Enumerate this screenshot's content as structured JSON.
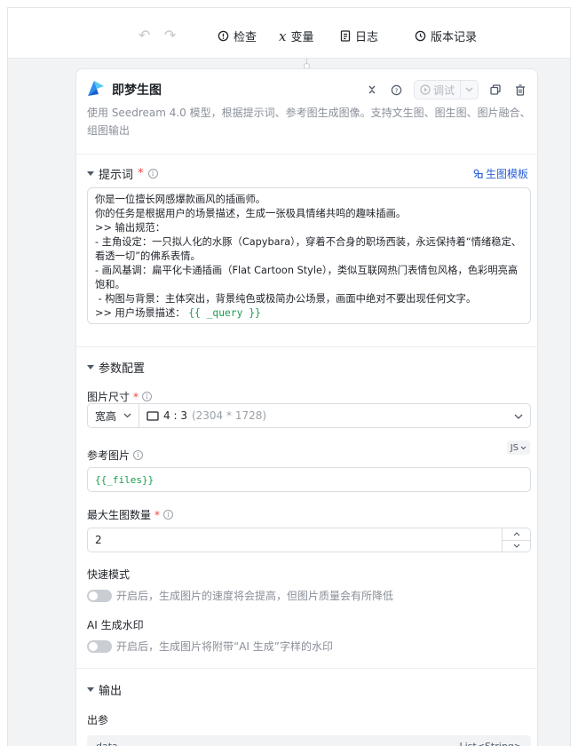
{
  "toolbar": {
    "check": "检查",
    "variables": "变量",
    "logs": "日志",
    "versions": "版本记录"
  },
  "node": {
    "title": "即梦生图",
    "debug_label": "调试",
    "description": "使用 Seedream 4.0 模型，根据提示词、参考图生成图像。支持文生图、图生图、图片融合、组图输出"
  },
  "prompt": {
    "label": "提示词",
    "required_mark": "*",
    "template_link": "生图模板",
    "lines": [
      "你是一位擅长网感爆款画风的插画师。",
      "你的任务是根据用户的场景描述，生成一张极具情绪共鸣的趣味插画。",
      ">> 输出规范：",
      "- 主角设定：一只拟人化的水豚（Capybara），穿着不合身的职场西装，永远保持着“情绪稳定、看透一切”的佛系表情。",
      "- 画风基调：扁平化卡通插画（Flat Cartoon Style），类似互联网热门表情包风格，色彩明亮高饱和。",
      " - 构图与背景：主体突出，背景纯色或极简办公场景，画面中绝对不要出现任何文字。"
    ],
    "last_line_prefix": ">> 用户场景描述： ",
    "last_line_var": "{{ _query }}"
  },
  "params": {
    "section_label": "参数配置",
    "image_size_label": "图片尺寸",
    "size_mode": "宽高",
    "ratio": "4 : 3",
    "ratio_px": "(2304 * 1728)",
    "ref_image_label": "参考图片",
    "ref_image_type": "JS",
    "ref_image_value": "{{_files}}",
    "max_count_label": "最大生图数量",
    "max_count_value": "2",
    "fast_mode_label": "快速模式",
    "fast_mode_desc": "开启后，生成图片的速度将会提高，但图片质量会有所降低",
    "fast_mode_on": false,
    "watermark_label": "AI 生成水印",
    "watermark_desc": "开启后，生成图片将附带“AI 生成”字样的水印",
    "watermark_on": false
  },
  "output": {
    "section_label": "输出",
    "params_label": "出参",
    "row_name": "data",
    "row_type": "List<String>"
  }
}
